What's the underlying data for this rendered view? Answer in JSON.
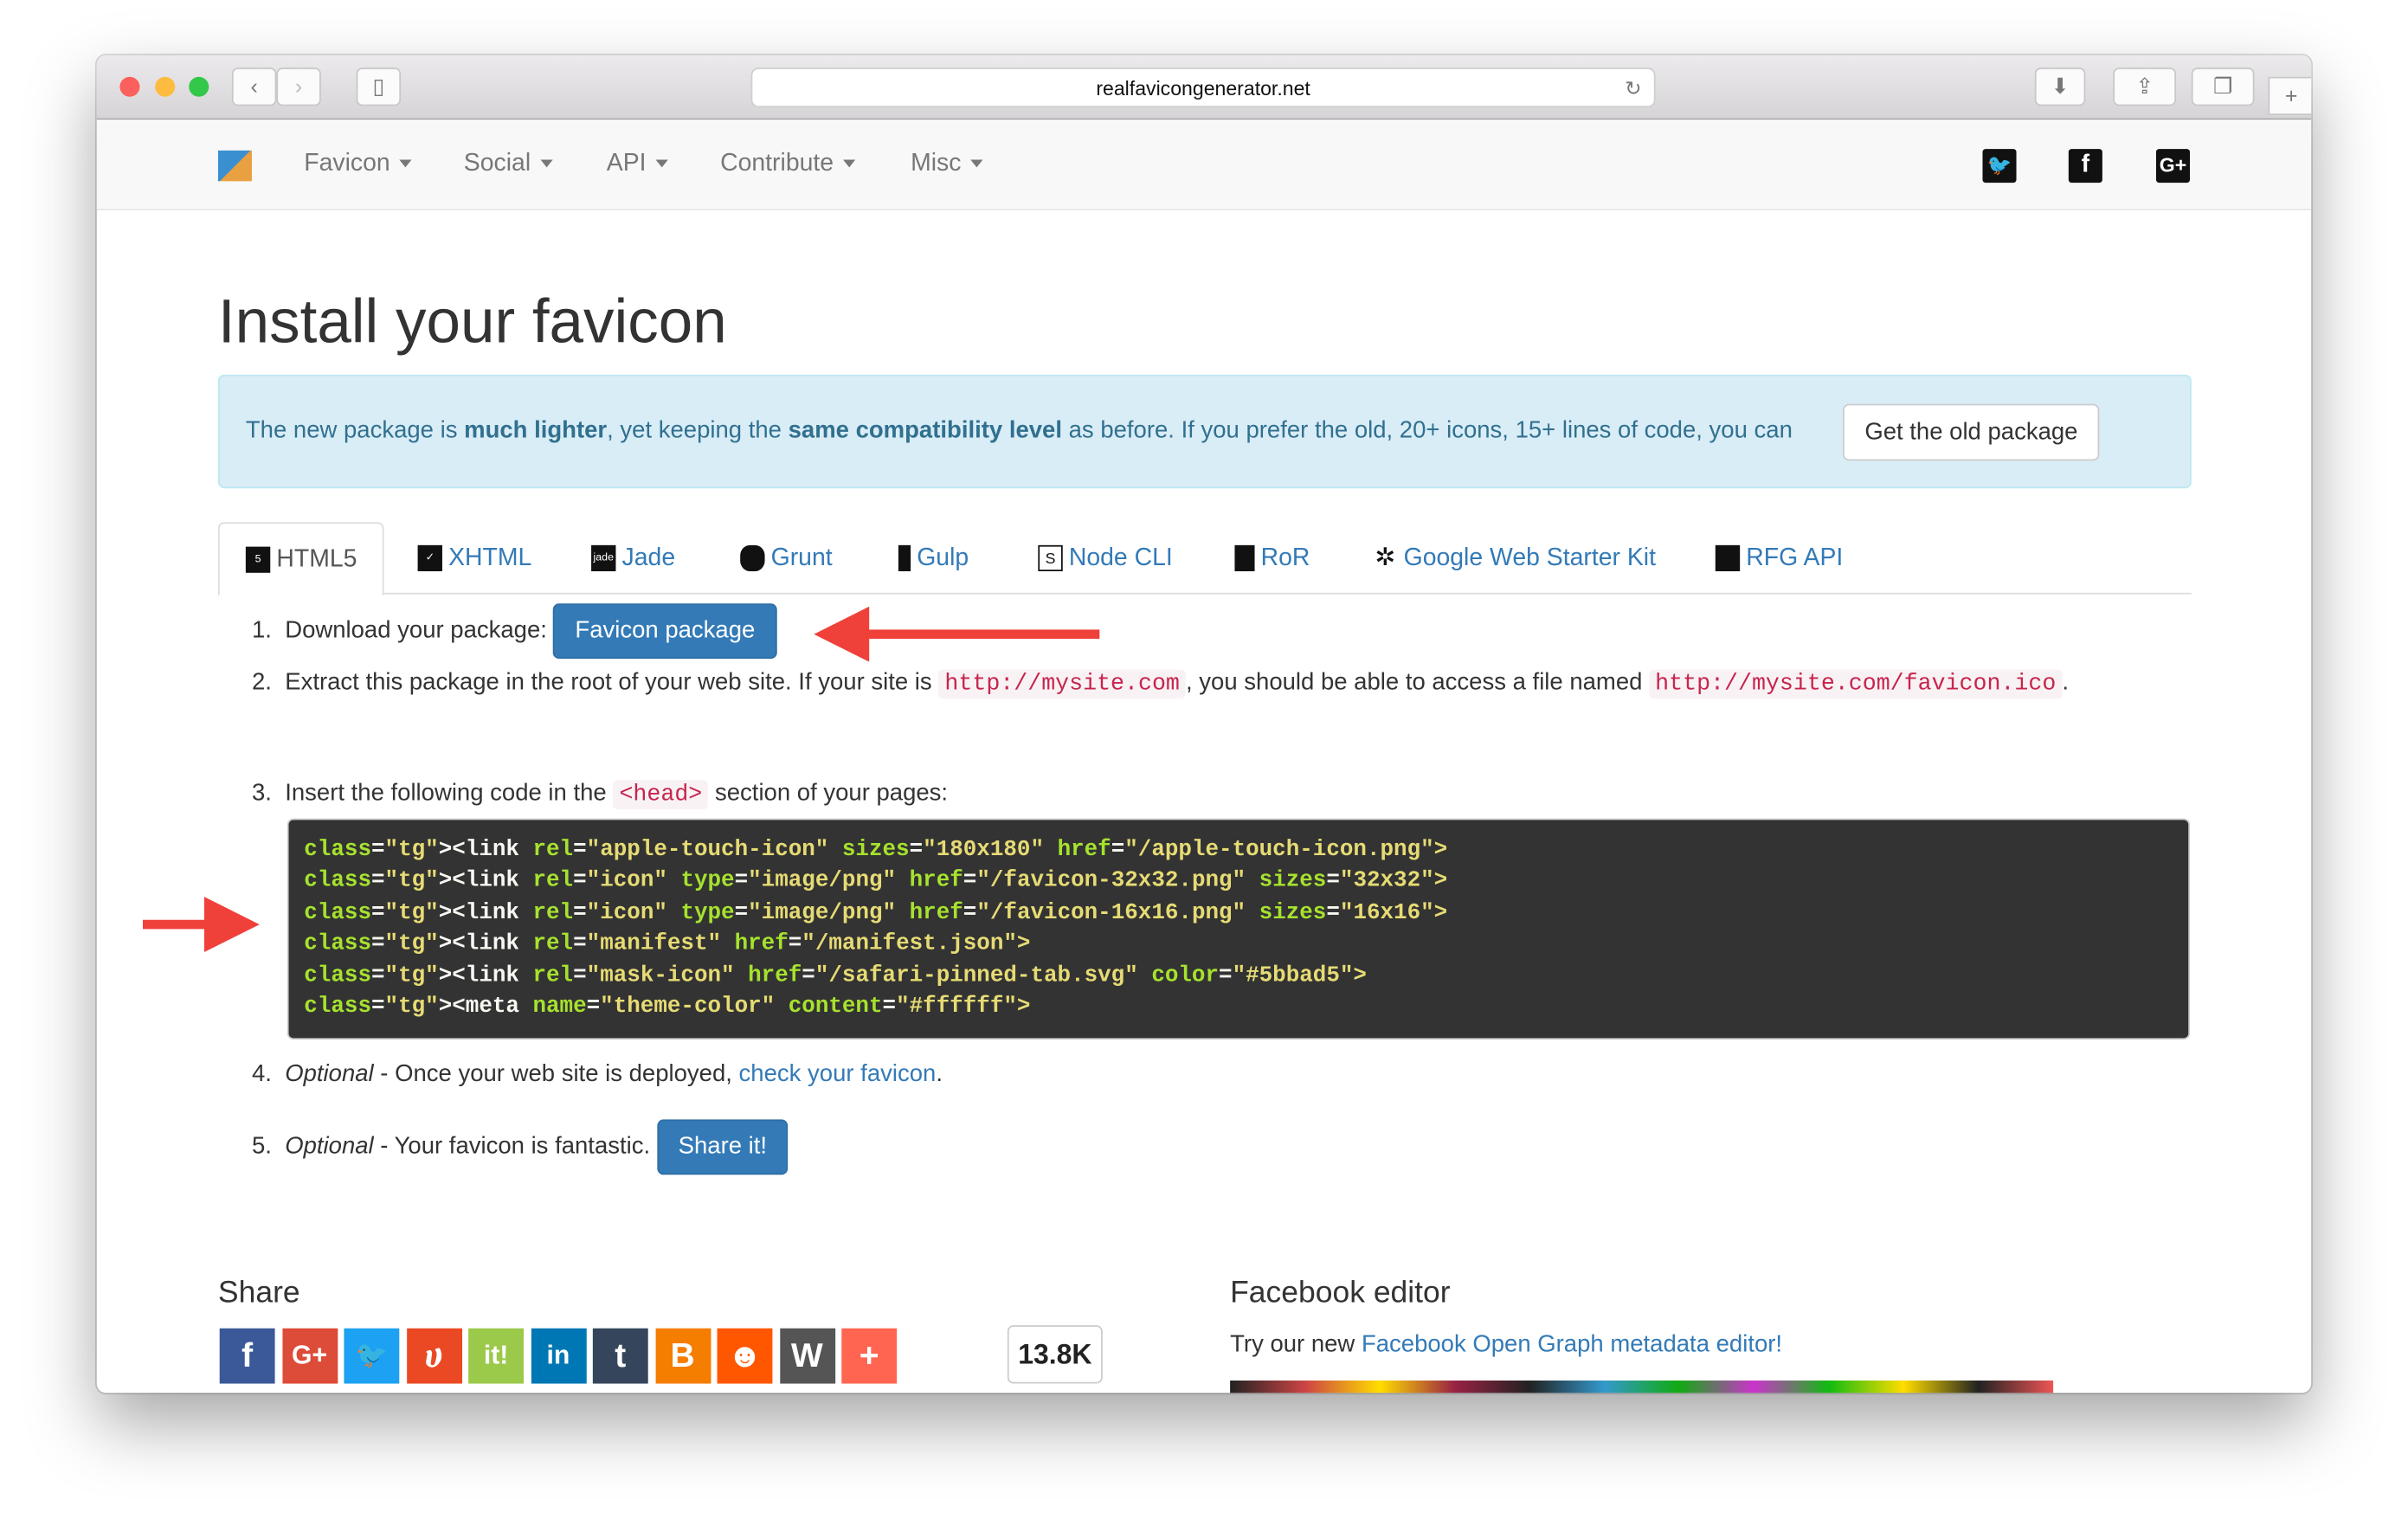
{
  "browser": {
    "url": "realfavicongenerator.net"
  },
  "nav": {
    "items": [
      "Favicon",
      "Social",
      "API",
      "Contribute",
      "Misc"
    ],
    "social": [
      "twitter-icon",
      "facebook-icon",
      "google-plus-icon"
    ]
  },
  "page": {
    "title": "Install your favicon",
    "alert": {
      "t1": "The new package is ",
      "b1": "much lighter",
      "t2": ", yet keeping the ",
      "b2": "same compatibility level",
      "t3": " as before. If you prefer the old, 20+ icons, 15+ lines of code, you can",
      "button": "Get the old package"
    },
    "tabs": [
      "HTML5",
      "XHTML",
      "Jade",
      "Grunt",
      "Gulp",
      "Node CLI",
      "RoR",
      "Google Web Starter Kit",
      "RFG API"
    ],
    "steps": {
      "s1": {
        "num": "1.",
        "text": "Download your package:",
        "button": "Favicon package"
      },
      "s2": {
        "num": "2.",
        "t1": "Extract this package in the root of your web site. If your site is ",
        "c1": "http://mysite.com",
        "t2": ", you should be able to access a file named ",
        "c2": "http://mysite.com/favicon.ico",
        "t3": "."
      },
      "s3": {
        "num": "3.",
        "t1": "Insert the following code in the ",
        "c1": "<head>",
        "t2": " section of your pages:"
      },
      "s4": {
        "num": "4.",
        "em": "Optional",
        "t1": " - Once your web site is deployed, ",
        "link": "check your favicon",
        "t2": "."
      },
      "s5": {
        "num": "5.",
        "em": "Optional",
        "t1": " - Your favicon is fantastic.",
        "button": "Share it!"
      }
    },
    "code": [
      "<link rel=\"apple-touch-icon\" sizes=\"180x180\" href=\"/apple-touch-icon.png\">",
      "<link rel=\"icon\" type=\"image/png\" href=\"/favicon-32x32.png\" sizes=\"32x32\">",
      "<link rel=\"icon\" type=\"image/png\" href=\"/favicon-16x16.png\" sizes=\"16x16\">",
      "<link rel=\"manifest\" href=\"/manifest.json\">",
      "<link rel=\"mask-icon\" href=\"/safari-pinned-tab.svg\" color=\"#5bbad5\">",
      "<meta name=\"theme-color\" content=\"#ffffff\">"
    ],
    "share": {
      "title": "Share",
      "count": "13.8K",
      "buttons": [
        {
          "name": "facebook",
          "glyph": "f",
          "color": "#3b5998"
        },
        {
          "name": "google-plus",
          "glyph": "G+",
          "color": "#dd4b39"
        },
        {
          "name": "twitter",
          "glyph": "🐦",
          "color": "#1da1f2"
        },
        {
          "name": "stumbleupon",
          "glyph": "ሀ",
          "color": "#eb4924"
        },
        {
          "name": "scoopit",
          "glyph": "it!",
          "color": "#9bc94a"
        },
        {
          "name": "linkedin",
          "glyph": "in",
          "color": "#0077b5"
        },
        {
          "name": "tumblr",
          "glyph": "t",
          "color": "#35465c"
        },
        {
          "name": "blogger",
          "glyph": "B",
          "color": "#f57d00"
        },
        {
          "name": "reddit",
          "glyph": "☻",
          "color": "#ff5700"
        },
        {
          "name": "wordpress",
          "glyph": "W",
          "color": "#555"
        },
        {
          "name": "more",
          "glyph": "+",
          "color": "#ff6550"
        }
      ]
    },
    "facebook": {
      "title": "Facebook editor",
      "text": "Try our new ",
      "link": "Facebook Open Graph metadata editor!"
    }
  }
}
